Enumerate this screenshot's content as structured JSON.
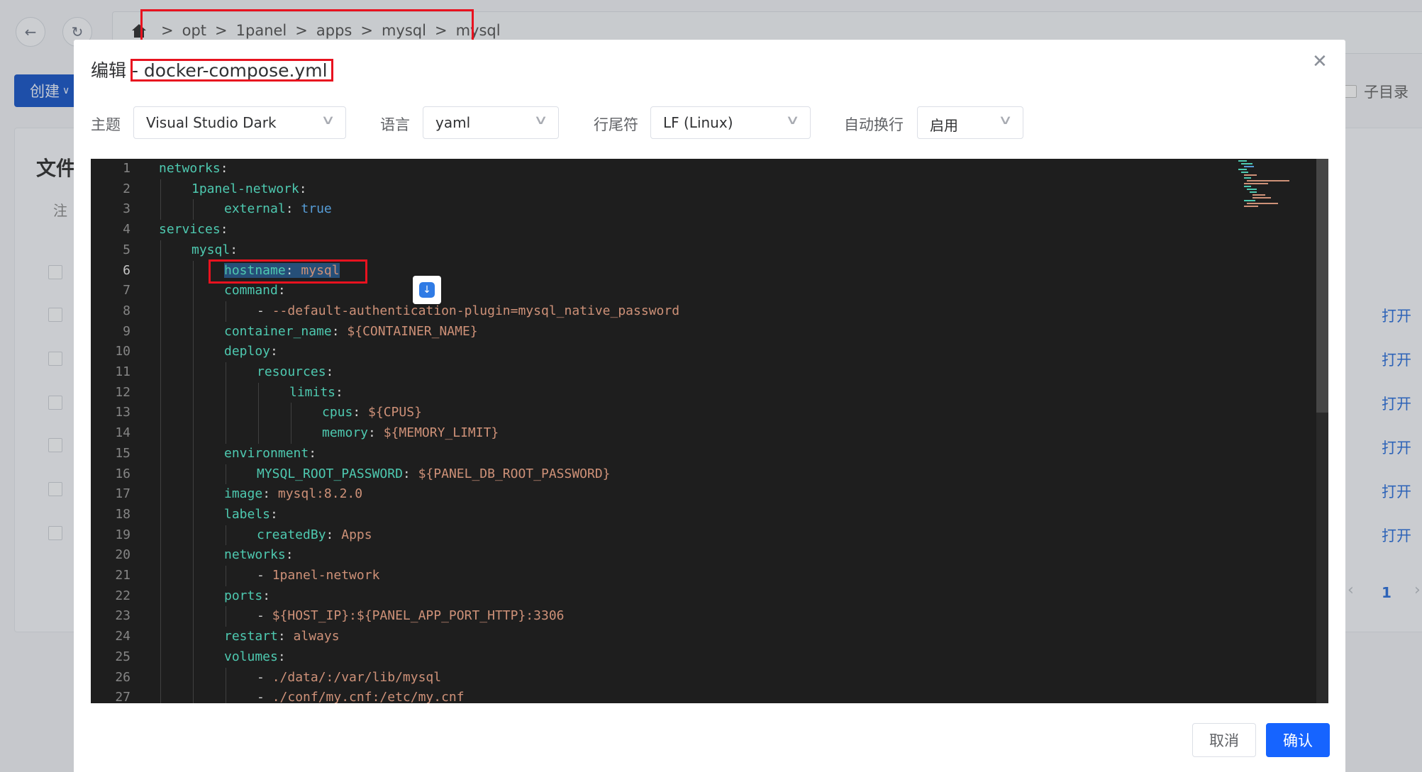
{
  "background": {
    "breadcrumb": [
      "opt",
      "1panel",
      "apps",
      "mysql",
      "mysql"
    ],
    "breadcrumb_separator": ">",
    "create_button": "创建",
    "subdir_label": "子目录",
    "card_title": "文件",
    "card_note": "注",
    "open_link": "打开",
    "page_number": "1"
  },
  "dialog": {
    "title_prefix": "编辑",
    "title_file": " - docker-compose.yml",
    "theme_label": "主题",
    "theme_value": "Visual Studio Dark",
    "language_label": "语言",
    "language_value": "yaml",
    "eol_label": "行尾符",
    "eol_value": "LF (Linux)",
    "wrap_label": "自动换行",
    "wrap_value": "启用",
    "cancel_button": "取消",
    "confirm_button": "确认"
  },
  "editor": {
    "active_line": 6,
    "lines": [
      {
        "n": "1",
        "indent": 0,
        "key": "networks",
        "sep": ":",
        "val": "",
        "vtype": ""
      },
      {
        "n": "2",
        "indent": 1,
        "key": "1panel-network",
        "sep": ":",
        "val": "",
        "vtype": ""
      },
      {
        "n": "3",
        "indent": 2,
        "key": "external",
        "sep": ": ",
        "val": "true",
        "vtype": "b"
      },
      {
        "n": "4",
        "indent": 0,
        "key": "services",
        "sep": ":",
        "val": "",
        "vtype": ""
      },
      {
        "n": "5",
        "indent": 1,
        "key": "mysql",
        "sep": ":",
        "val": "",
        "vtype": ""
      },
      {
        "n": "6",
        "indent": 2,
        "key": "hostname",
        "sep": ": ",
        "val": "mysql",
        "vtype": "s"
      },
      {
        "n": "7",
        "indent": 2,
        "key": "command",
        "sep": ":",
        "val": "",
        "vtype": ""
      },
      {
        "n": "8",
        "indent": 3,
        "key": "",
        "sep": "- ",
        "val": "--default-authentication-plugin=mysql_native_password",
        "vtype": "s"
      },
      {
        "n": "9",
        "indent": 2,
        "key": "container_name",
        "sep": ": ",
        "val": "${CONTAINER_NAME}",
        "vtype": "s"
      },
      {
        "n": "10",
        "indent": 2,
        "key": "deploy",
        "sep": ":",
        "val": "",
        "vtype": ""
      },
      {
        "n": "11",
        "indent": 3,
        "key": "resources",
        "sep": ":",
        "val": "",
        "vtype": ""
      },
      {
        "n": "12",
        "indent": 4,
        "key": "limits",
        "sep": ":",
        "val": "",
        "vtype": ""
      },
      {
        "n": "13",
        "indent": 5,
        "key": "cpus",
        "sep": ": ",
        "val": "${CPUS}",
        "vtype": "s"
      },
      {
        "n": "14",
        "indent": 5,
        "key": "memory",
        "sep": ": ",
        "val": "${MEMORY_LIMIT}",
        "vtype": "s"
      },
      {
        "n": "15",
        "indent": 2,
        "key": "environment",
        "sep": ":",
        "val": "",
        "vtype": ""
      },
      {
        "n": "16",
        "indent": 3,
        "key": "MYSQL_ROOT_PASSWORD",
        "sep": ": ",
        "val": "${PANEL_DB_ROOT_PASSWORD}",
        "vtype": "s"
      },
      {
        "n": "17",
        "indent": 2,
        "key": "image",
        "sep": ": ",
        "val": "mysql:8.2.0",
        "vtype": "s"
      },
      {
        "n": "18",
        "indent": 2,
        "key": "labels",
        "sep": ":",
        "val": "",
        "vtype": ""
      },
      {
        "n": "19",
        "indent": 3,
        "key": "createdBy",
        "sep": ": ",
        "val": "Apps",
        "vtype": "s"
      },
      {
        "n": "20",
        "indent": 2,
        "key": "networks",
        "sep": ":",
        "val": "",
        "vtype": ""
      },
      {
        "n": "21",
        "indent": 3,
        "key": "",
        "sep": "- ",
        "val": "1panel-network",
        "vtype": "s"
      },
      {
        "n": "22",
        "indent": 2,
        "key": "ports",
        "sep": ":",
        "val": "",
        "vtype": ""
      },
      {
        "n": "23",
        "indent": 3,
        "key": "",
        "sep": "- ",
        "val": "${HOST_IP}:${PANEL_APP_PORT_HTTP}:3306",
        "vtype": "s"
      },
      {
        "n": "24",
        "indent": 2,
        "key": "restart",
        "sep": ": ",
        "val": "always",
        "vtype": "s"
      },
      {
        "n": "25",
        "indent": 2,
        "key": "volumes",
        "sep": ":",
        "val": "",
        "vtype": ""
      },
      {
        "n": "26",
        "indent": 3,
        "key": "",
        "sep": "- ",
        "val": "./data/:/var/lib/mysql",
        "vtype": "s"
      },
      {
        "n": "27",
        "indent": 3,
        "key": "",
        "sep": "- ",
        "val": "./conf/my.cnf:/etc/my.cnf",
        "vtype": "s"
      }
    ]
  },
  "colors": {
    "key": "#4ec9b0",
    "string": "#ce9178",
    "boolean": "#569cd6",
    "editor_bg": "#1e1e1e",
    "primary": "#1664ff",
    "highlight_box": "#e8121f"
  }
}
